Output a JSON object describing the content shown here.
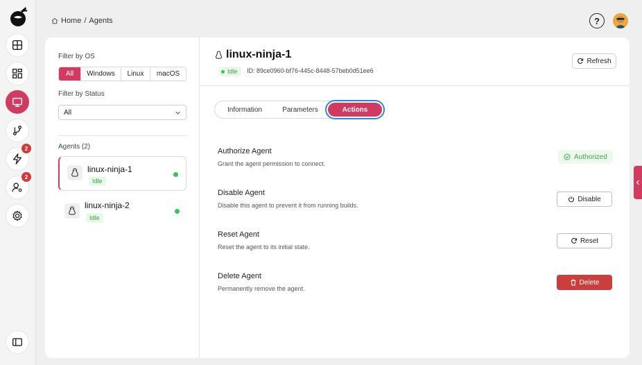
{
  "breadcrumb": {
    "home": "Home",
    "separator": "/",
    "current": "Agents"
  },
  "header": {
    "help_label": "?"
  },
  "rail": {
    "badge_deployments": "2",
    "badge_users": "2"
  },
  "filters": {
    "os_label": "Filter by OS",
    "os_options": [
      "All",
      "Windows",
      "Linux",
      "macOS"
    ],
    "os_selected": "All",
    "status_label": "Filter by Status",
    "status_value": "All"
  },
  "agents": {
    "header": "Agents (2)",
    "items": [
      {
        "name": "linux-ninja-1",
        "status": "Idle"
      },
      {
        "name": "linux-ninja-2",
        "status": "Idle"
      }
    ]
  },
  "detail": {
    "title": "linux-ninja-1",
    "status": "Idle",
    "id_text": "ID: 89ce0960-bf76-445c-8448-57beb0d51ee6",
    "refresh_label": "Refresh",
    "tabs": [
      "Information",
      "Parameters",
      "Actions"
    ],
    "active_tab": "Actions",
    "actions": [
      {
        "title": "Authorize Agent",
        "desc": "Grant the agent permission to connect.",
        "control": "Authorized"
      },
      {
        "title": "Disable Agent",
        "desc": "Disable this agent to prevent it from running builds.",
        "control": "Disable"
      },
      {
        "title": "Reset Agent",
        "desc": "Reset the agent to its initial state.",
        "control": "Reset"
      },
      {
        "title": "Delete Agent",
        "desc": "Permanently remove the agent.",
        "control": "Delete"
      }
    ]
  },
  "colors": {
    "accent": "#d13a61",
    "danger": "#cc3d3d",
    "success": "#3aa845",
    "focus": "#2b86d9"
  },
  "icons": [
    "logo-icon",
    "dashboard-icon",
    "grid-icon",
    "monitor-icon",
    "branch-icon",
    "lightning-icon",
    "user-settings-icon",
    "gear-icon",
    "sidebar-toggle-icon",
    "home-icon",
    "help-icon",
    "linux-icon",
    "refresh-icon",
    "check-circle-icon",
    "power-icon",
    "rotate-icon",
    "trash-icon",
    "chevron-down-icon",
    "chevron-left-icon"
  ]
}
